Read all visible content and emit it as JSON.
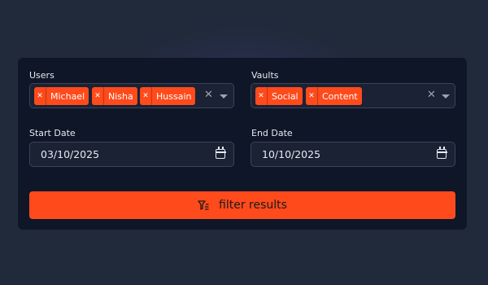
{
  "colors": {
    "accent": "#ff4a1c",
    "panel": "#0f1627",
    "background": "#212a3b"
  },
  "users": {
    "label": "Users",
    "chips": [
      "Michael",
      "Nisha",
      "Hussain"
    ],
    "chip_remove_icon": "close-icon",
    "clear_icon": "close-icon",
    "dropdown_icon": "caret-down-icon"
  },
  "vaults": {
    "label": "Vaults",
    "chips": [
      "Social",
      "Content"
    ],
    "chip_remove_icon": "close-icon",
    "clear_icon": "close-icon",
    "dropdown_icon": "caret-down-icon"
  },
  "start_date": {
    "label": "Start Date",
    "value": "03/10/2025",
    "icon": "calendar-icon"
  },
  "end_date": {
    "label": "End Date",
    "value": "10/10/2025",
    "icon": "calendar-icon"
  },
  "filter_button": {
    "label": "filter results",
    "icon": "filter-icon"
  }
}
